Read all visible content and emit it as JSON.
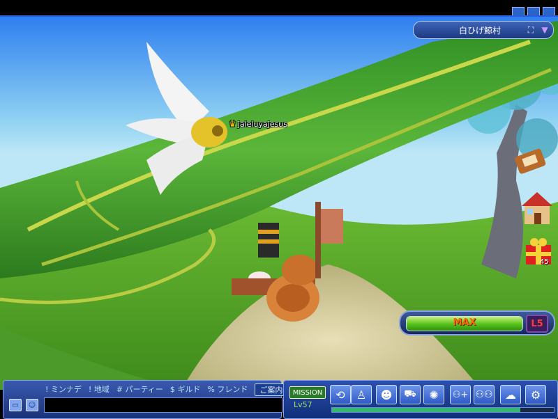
{
  "game": {
    "location": "白ひげ鯨村",
    "player_name": "jaleluyajesus"
  },
  "gift": {
    "count": "45"
  },
  "gauge": {
    "label": "MAX",
    "level_label": "L5",
    "fill_fraction": 1.0
  },
  "chat": {
    "tabs": [
      "! ミンナデ",
      "! 地域",
      "# パーティー",
      "$ ギルド",
      "% フレンド",
      "ご案内"
    ],
    "active_tab": 5,
    "input_value": ""
  },
  "actionbar": {
    "mission_label": "MISSION",
    "level_text": "Lv57",
    "exp_fraction": 0.85,
    "buttons": [
      {
        "name": "rotate-icon"
      },
      {
        "name": "character-icon"
      },
      {
        "name": "profile-icon"
      },
      {
        "name": "vehicle-icon"
      },
      {
        "name": "sparkle-icon"
      },
      {
        "name": "party-add-icon"
      },
      {
        "name": "friends-icon"
      },
      {
        "name": "chat-bubble-icon"
      },
      {
        "name": "settings-icon"
      }
    ]
  },
  "colors": {
    "ui_blue": "#2b4fb0",
    "exp_green": "#36b870",
    "max_text": "#ff6a00",
    "level_red": "#ff3a3a"
  }
}
